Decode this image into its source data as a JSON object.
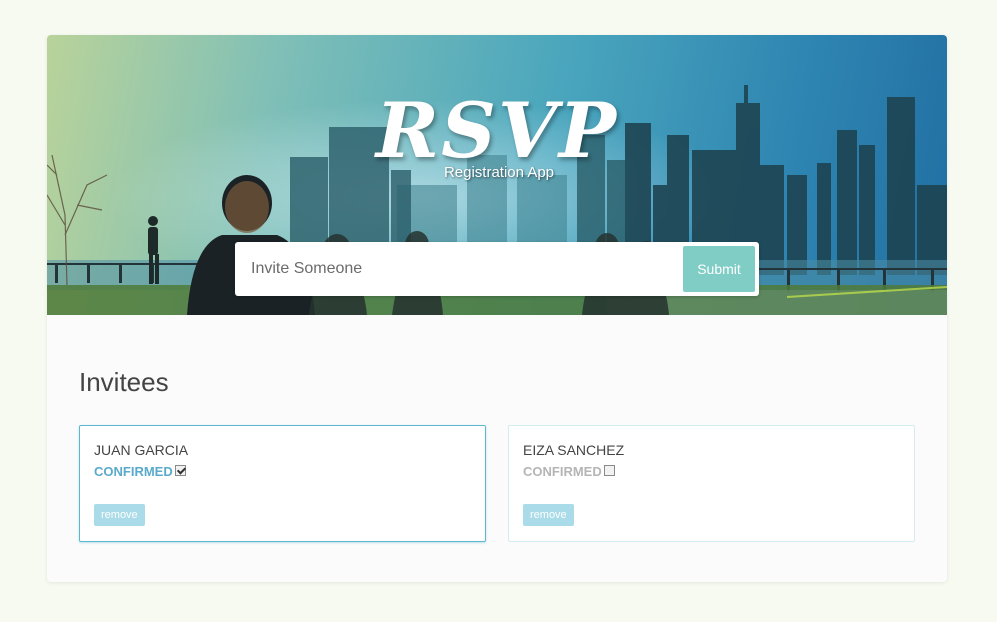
{
  "header": {
    "logo_text": "RSVP",
    "subtitle": "Registration App"
  },
  "invite_form": {
    "placeholder": "Invite Someone",
    "submit_label": "Submit"
  },
  "main": {
    "section_title": "Invitees",
    "invitees": [
      {
        "name": "JUAN GARCIA",
        "confirmed_label": "CONFIRMED",
        "confirmed": true,
        "remove_label": "remove"
      },
      {
        "name": "EIZA SANCHEZ",
        "confirmed_label": "CONFIRMED",
        "confirmed": false,
        "remove_label": "remove"
      }
    ]
  },
  "colors": {
    "accent": "#7fcdc5",
    "confirmed_text": "#5aaacb",
    "remove_button": "#a9dbe9",
    "page_background": "#f6faf0"
  }
}
